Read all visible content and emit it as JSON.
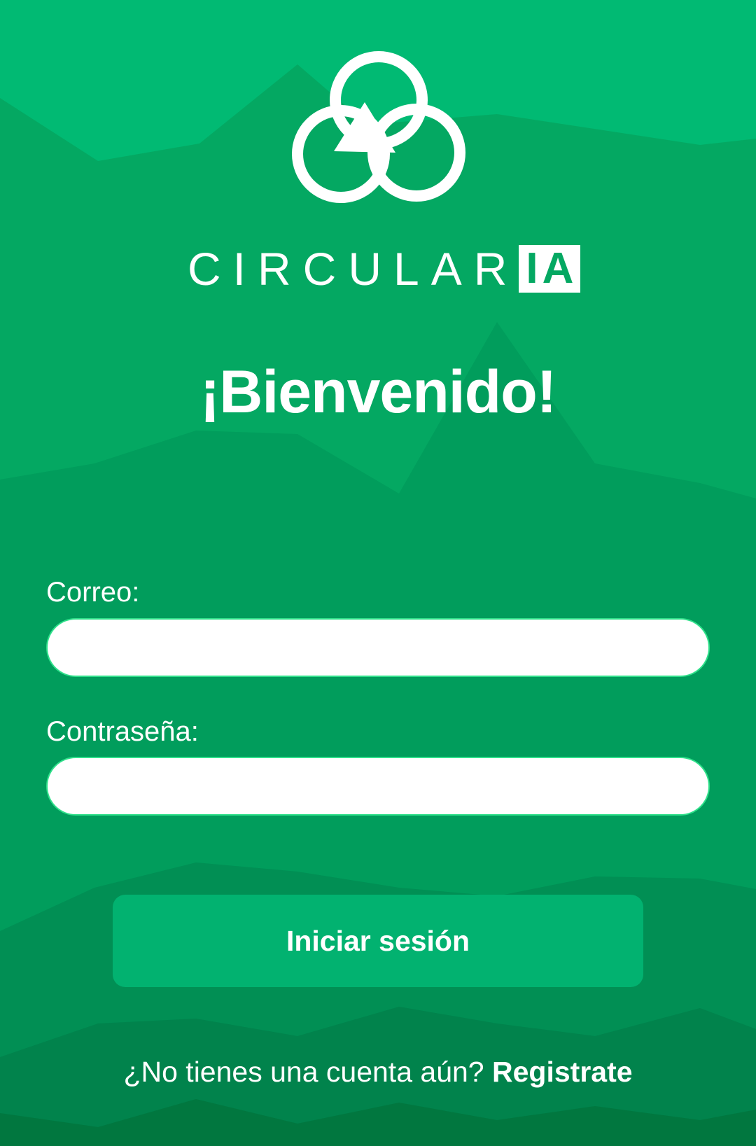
{
  "brand": {
    "name_main": "CIRCULAR",
    "name_highlight": "IA",
    "logo_icon": "recycle-circles-icon"
  },
  "welcome": {
    "title": "¡Bienvenido!"
  },
  "form": {
    "email_label": "Correo:",
    "email_value": "",
    "password_label": "Contraseña:",
    "password_value": ""
  },
  "actions": {
    "login_label": "Iniciar sesión"
  },
  "footer": {
    "prompt": "¿No tienes una cuenta aún?",
    "register_label": "Registrate"
  },
  "colors": {
    "background_top": "#01ba73",
    "button": "#02b270",
    "input_border": "#2fe08a",
    "text": "#ffffff"
  }
}
